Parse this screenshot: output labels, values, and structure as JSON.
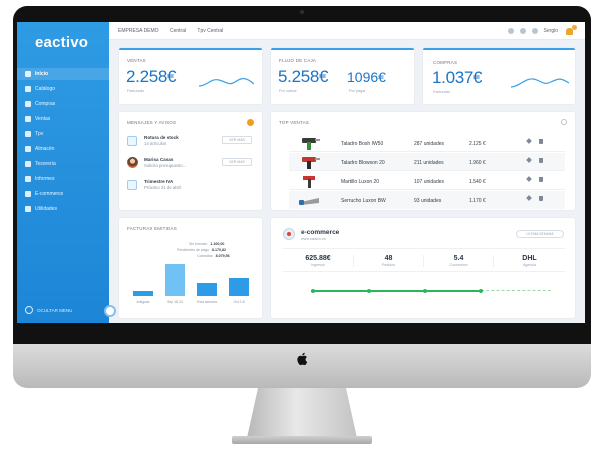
{
  "app": {
    "logo": "eactivo"
  },
  "topbar": {
    "company": "EMPRESA DEMO",
    "location": "Central",
    "tpv": "Tpv Central",
    "user": "Sergio"
  },
  "sidebar": {
    "items": [
      {
        "label": "Inicio",
        "icon": "home-icon"
      },
      {
        "label": "Catálogo",
        "icon": "catalog-icon"
      },
      {
        "label": "Compras",
        "icon": "purchases-icon"
      },
      {
        "label": "Ventas",
        "icon": "sales-icon"
      },
      {
        "label": "Tpv",
        "icon": "pos-icon"
      },
      {
        "label": "Almacén",
        "icon": "warehouse-icon"
      },
      {
        "label": "Tesorería",
        "icon": "treasury-icon"
      },
      {
        "label": "Informes",
        "icon": "reports-icon"
      },
      {
        "label": "E-commerce",
        "icon": "ecommerce-icon"
      },
      {
        "label": "Utilidades",
        "icon": "utilities-icon"
      }
    ],
    "hide_label": "OCULTAR MENU"
  },
  "kpis": {
    "ventas": {
      "title": "VENTAS",
      "value": "2.258€",
      "sub": "Facturado"
    },
    "caja": {
      "title": "FLUJO DE CAJA",
      "value1": "5.258€",
      "sub1": "Por cobrar",
      "value2": "1096€",
      "sub2": "Por pagar"
    },
    "compras": {
      "title": "COMPRAS",
      "value": "1.037€",
      "sub": "Facturado"
    }
  },
  "messages": {
    "title": "MENSAJES Y AVISOS",
    "items": [
      {
        "title": "Rotura de stock",
        "sub": "14 artículos",
        "button": "VER MÁS"
      },
      {
        "title": "Marisa Casas",
        "sub": "Solicito presupuesto...",
        "button": "VER MÁS"
      },
      {
        "title": "Trimestre IVA",
        "sub": "Próximo 21 de abril"
      }
    ]
  },
  "top_sales": {
    "title": "TOP VENTAS",
    "rows": [
      {
        "product": "Taladro Bosh IW50",
        "qty": "287 unidades",
        "amount": "2.125 €"
      },
      {
        "product": "Taladro Blowson 20",
        "qty": "211 unidades",
        "amount": "1.960 €"
      },
      {
        "product": "Martillo Luxon 20",
        "qty": "107 unidades",
        "amount": "1.540 €"
      },
      {
        "product": "Serrucho Luxon BW",
        "qty": "93 unidades",
        "amount": "1.170 €"
      }
    ]
  },
  "invoices": {
    "title": "FACTURAS EMITIDAS",
    "legend": [
      {
        "label": "Sin formato",
        "value": "1.100,00"
      },
      {
        "label": "Pendientes de pago",
        "value": "8.170,82"
      },
      {
        "label": "Cobradas",
        "value": "8.079,56"
      }
    ],
    "categories": [
      "Antiguas",
      "Sep 18-24",
      "Esta semana",
      "Oct 2-8"
    ],
    "values": [
      4,
      28,
      11,
      16
    ]
  },
  "ecommerce": {
    "title": "e-commerce",
    "subtitle": "www.eactivo.es",
    "button": "ÚLTIMA SEMANA",
    "metrics": [
      {
        "value": "625.88€",
        "label": "Ingresos"
      },
      {
        "value": "48",
        "label": "Pedidos"
      },
      {
        "value": "5.4",
        "label": "Conversión"
      },
      {
        "value": "DHL",
        "label": "Agencia"
      }
    ]
  }
}
